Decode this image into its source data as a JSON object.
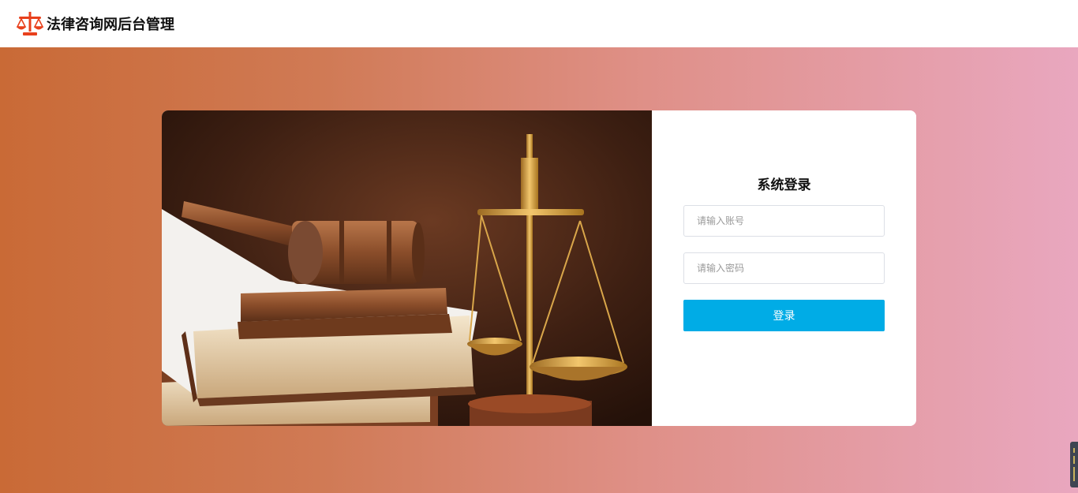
{
  "header": {
    "logo_icon": "scales-of-justice-icon",
    "title": "法律咨询网后台管理",
    "logo_color": "#e8401c"
  },
  "background": {
    "gradient_start": "#c96a36",
    "gradient_end": "#e9a7bf"
  },
  "hero_image": {
    "subject": "gavel-books-and-scales-photo"
  },
  "login": {
    "title": "系统登录",
    "account_placeholder": "请输入账号",
    "password_placeholder": "请输入密码",
    "submit_label": "登录",
    "accent": "#00ace6"
  },
  "side_widget": {
    "icon": "volume-meter-icon"
  }
}
